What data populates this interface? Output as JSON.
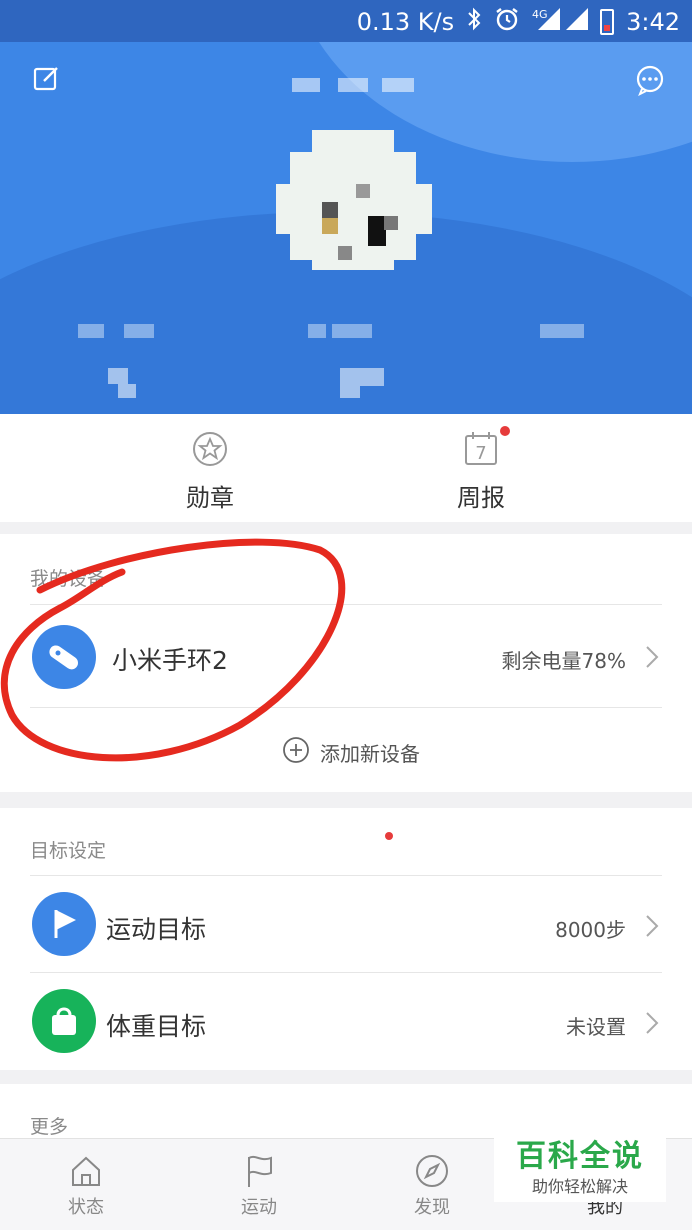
{
  "status_bar": {
    "network_speed": "0.13 K/s",
    "network_type": "4G",
    "time": "3:42",
    "icons": [
      "bluetooth-icon",
      "alarm-icon",
      "signal-icon",
      "battery-icon"
    ]
  },
  "header": {
    "edit_icon": "edit-icon",
    "message_icon": "chat-bubble-icon",
    "colors": {
      "background": "#3d86e6"
    }
  },
  "stats": {
    "medals_label": "勋章",
    "weekly_label": "周报",
    "weekly_icon_number": "7"
  },
  "devices": {
    "section_title": "我的设备",
    "device_name": "小米手环2",
    "battery_text": "剩余电量78%",
    "add_device_label": "添加新设备"
  },
  "goals": {
    "section_title": "目标设定",
    "items": [
      {
        "label": "运动目标",
        "value": "8000步",
        "icon": "flag-icon",
        "color": "#3d86e6"
      },
      {
        "label": "体重目标",
        "value": "未设置",
        "icon": "bag-icon",
        "color": "#17b35a"
      }
    ]
  },
  "more": {
    "section_title": "更多"
  },
  "bottom_nav": [
    {
      "label": "状态",
      "icon": "home-icon"
    },
    {
      "label": "运动",
      "icon": "flag-outline-icon"
    },
    {
      "label": "发现",
      "icon": "compass-icon"
    },
    {
      "label": "我的",
      "icon": "profile-icon"
    }
  ],
  "watermark": {
    "title": "百科全说",
    "subtitle": "助你轻松解决"
  }
}
